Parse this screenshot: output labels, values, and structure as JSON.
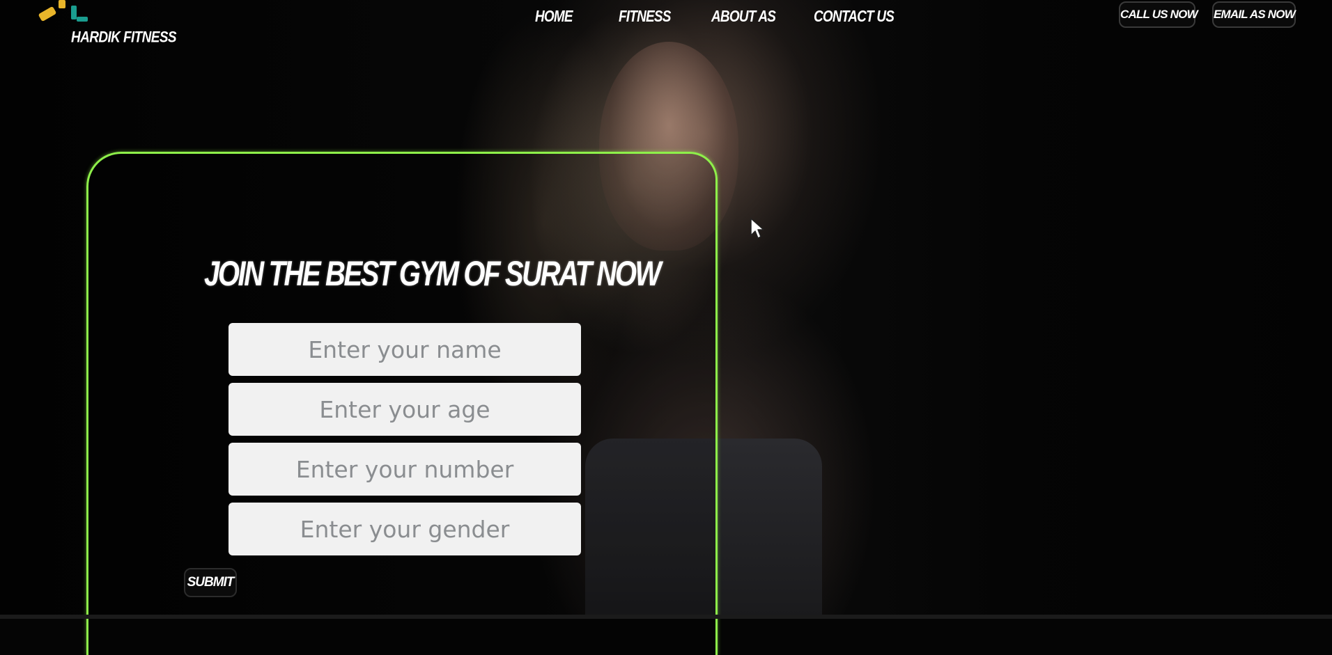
{
  "brand": {
    "name": "HARDIK FITNESS",
    "logo_icon": "dumbbell-logo-icon",
    "logo_colors": [
      "#e9b52a",
      "#1a9d8f"
    ]
  },
  "nav": {
    "items": [
      {
        "label": "HOME"
      },
      {
        "label": "FITNESS"
      },
      {
        "label": "ABOUT AS"
      },
      {
        "label": "CONTACT US"
      }
    ]
  },
  "actions": {
    "call": "CALL US NOW",
    "email": "EMAIL AS NOW"
  },
  "form": {
    "title": "JOIN THE BEST GYM OF SURAT NOW",
    "fields": [
      {
        "placeholder": "Enter your name",
        "value": ""
      },
      {
        "placeholder": "Enter your age",
        "value": ""
      },
      {
        "placeholder": "Enter your number",
        "value": ""
      },
      {
        "placeholder": "Enter your gender",
        "value": ""
      }
    ],
    "submit": "SUBMIT",
    "border_color": "#8ef04a"
  },
  "cursor_icon": "mouse-pointer-icon"
}
